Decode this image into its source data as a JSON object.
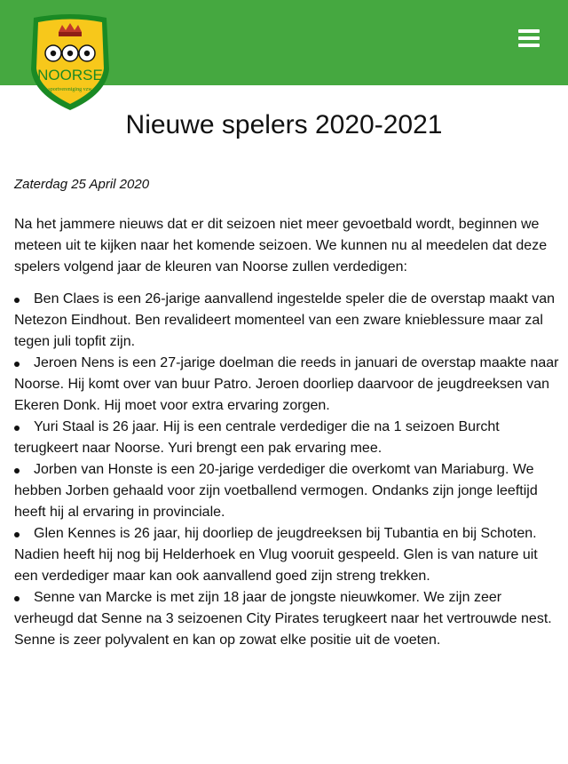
{
  "header": {
    "logo_text": "NOORSE",
    "logo_subtext": "sportvereniging vzw",
    "menu_icon": "hamburger-menu-icon",
    "bar_color": "#45a840",
    "logo_yellow": "#f7c81b",
    "logo_green": "#1a8a24"
  },
  "article": {
    "title": "Nieuwe spelers 2020-2021",
    "date": "Zaterdag 25 April 2020",
    "intro": "Na het jammere nieuws dat er dit seizoen niet meer gevoetbald wordt, beginnen we meteen uit te kijken naar het komende seizoen. We kunnen nu al meedelen dat deze spelers volgend jaar de kleuren van Noorse zullen verdedigen:",
    "players": [
      "Ben Claes is een 26-jarige aanvallend ingestelde speler die de overstap maakt van Netezon Eindhout. Ben revalideert momenteel van een zware knieblessure maar zal tegen juli topfit zijn.",
      "Jeroen Nens is een 27-jarige doelman die reeds in januari de overstap maakte naar Noorse. Hij komt over van buur Patro. Jeroen doorliep daarvoor de jeugdreeksen van Ekeren Donk. Hij moet voor extra ervaring zorgen.",
      "Yuri Staal is 26 jaar. Hij is een centrale verdediger die na 1 seizoen Burcht terugkeert naar Noorse. Yuri brengt een pak ervaring mee.",
      "Jorben van Honste is een 20-jarige verdediger die overkomt van Mariaburg. We hebben Jorben gehaald voor zijn voetballend vermogen. Ondanks zijn jonge leeftijd heeft hij al ervaring in provinciale.",
      "Glen Kennes is 26 jaar, hij doorliep de jeugdreeksen bij Tubantia en bij Schoten. Nadien heeft hij nog bij Helderhoek en Vlug vooruit gespeeld. Glen is van nature uit een verdediger maar kan ook aanvallend goed zijn streng trekken.",
      "Senne van Marcke is met zijn 18 jaar de jongste nieuwkomer. We zijn zeer verheugd dat Senne na 3 seizoenen City Pirates terugkeert naar het vertrouwde nest. Senne is zeer polyvalent en kan op zowat elke positie uit de voeten."
    ]
  }
}
